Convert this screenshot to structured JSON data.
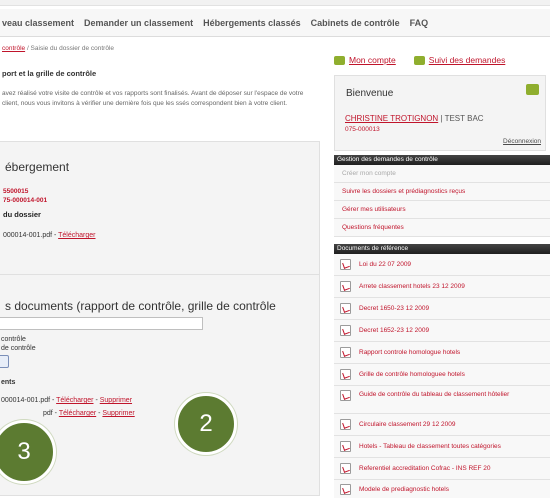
{
  "nav": {
    "items": [
      "veau classement",
      "Demander un classement",
      "Hébergements classés",
      "Cabinets de contrôle",
      "FAQ"
    ]
  },
  "breadcrumb": {
    "link": "contrôle",
    "rest": "/ Saisie du dossier de contrôle"
  },
  "page": {
    "subtitle": "port et la grille de contrôle",
    "intro": "avez réalisé votre visite de contrôle et vos rapports sont finalisés. Avant de déposer sur l'espace de votre client, nous vous invitons à vérifier une dernière fois que les ssés correspondent bien à votre client."
  },
  "hebergement_box": {
    "title": "ébergement",
    "line1": "5500015",
    "line2": "75-000014-001",
    "dossier_label": "du dossier",
    "file_prefix": "000014-001.pdf - ",
    "download": "Télécharger"
  },
  "documents_box": {
    "title": "s documents (rapport de contrôle, grille de contrôle",
    "option1": "contrôle",
    "option2": "de contrôle",
    "docs_label": "ents",
    "file1_prefix": "000014-001.pdf - ",
    "file2_prefix": "pdf - ",
    "download": "Télécharger",
    "separator": " - ",
    "delete": "Supprimer"
  },
  "badges": {
    "b2": "2",
    "b3": "3"
  },
  "sidebar": {
    "mon_compte": "Mon compte",
    "suivi": "Suivi des demandes",
    "welcome_title": "Bienvenue",
    "user_name": "CHRISTINE TROTIGNON",
    "user_sep": " | ",
    "user_org": "TEST BAC",
    "user_code": "075-000013",
    "logout": "Déconnexion",
    "gestion_title": "Gestion des demandes de contrôle",
    "gestion_items": [
      "Créer mon compte",
      "Suivre les dossiers et prédiagnostics reçus",
      "Gérer mes utilisateurs",
      "Questions fréquentes"
    ],
    "docs_title": "Documents de référence",
    "docs_items": [
      "Loi du 22 07 2009",
      "Arrete classement hotels 23 12 2009",
      "Decret 1650-23 12 2009",
      "Decret 1652-23 12 2009",
      "Rapport controle homologue hotels",
      "Grille de contrôle homologuee hotels",
      "Guide de contrôle du tableau de classement hôtelier",
      "Circulaire classement 29 12 2009",
      "Hotels - Tableau de classement toutes catégories",
      "Referentiel accreditation Cofrac - INS REF 20",
      "Modele de prediagnostic hotels"
    ]
  },
  "colors": {
    "accent": "#c0142b",
    "badge": "#5c7b31",
    "icon_green": "#8fae2e"
  }
}
